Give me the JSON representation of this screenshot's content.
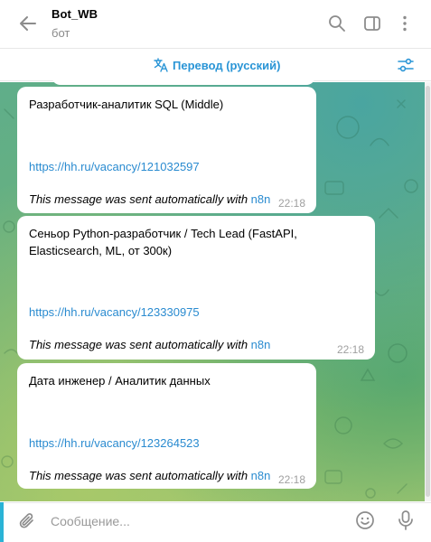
{
  "header": {
    "title": "Bot_WB",
    "subtitle": "бот",
    "icons": [
      "back-arrow-icon",
      "search-icon",
      "sidebar-toggle-icon",
      "more-vertical-icon"
    ]
  },
  "translate_bar": {
    "label": "Перевод (русский)",
    "icon": "translate-icon",
    "filter_icon": "filter-settings-icon"
  },
  "messages": [
    {
      "title": "Разработчик-аналитик SQL (Middle)",
      "link": "https://hh.ru/vacancy/121032597",
      "footer_text": "This message was sent automatically with",
      "footer_link": "n8n",
      "time": "22:18"
    },
    {
      "title": "Сеньор Python-разработчик / Tech Lead (FastAPI, Elasticsearch, ML, от 300к)",
      "link": "https://hh.ru/vacancy/123330975",
      "footer_text": "This message was sent automatically with",
      "footer_link": "n8n",
      "time": "22:18"
    },
    {
      "title": "Дата инженер / Аналитик данных",
      "link": "https://hh.ru/vacancy/123264523",
      "footer_text": "This message was sent automatically with",
      "footer_link": "n8n",
      "time": "22:18"
    }
  ],
  "composer": {
    "placeholder": "Сообщение...",
    "value": "",
    "icons": [
      "attach-icon",
      "emoji-icon",
      "microphone-icon"
    ]
  },
  "colors": {
    "accent": "#2a95d6",
    "link": "#2a8bd0",
    "chat_background": "#6cb17a"
  }
}
